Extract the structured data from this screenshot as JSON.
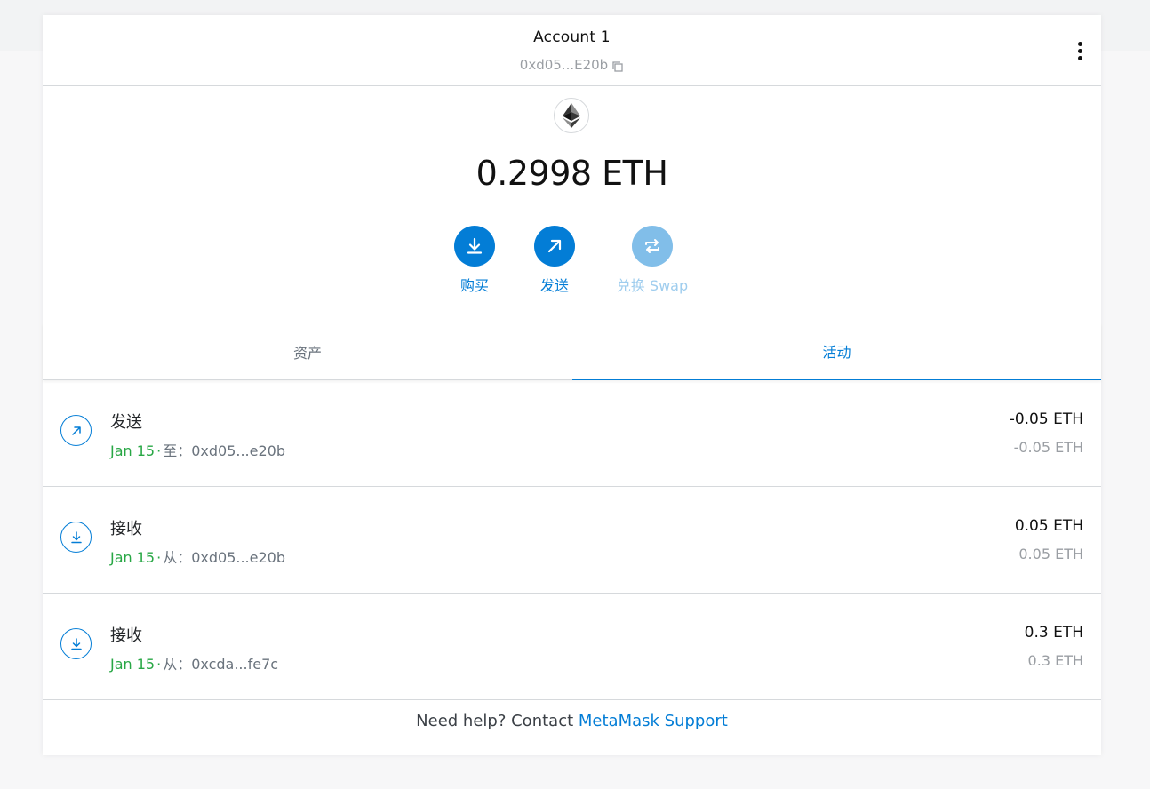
{
  "account": {
    "name": "Account 1",
    "address": "0xd05...E20b"
  },
  "balance": {
    "text": "0.2998 ETH"
  },
  "actions": {
    "buy": "购买",
    "send": "发送",
    "swap": "兑换 Swap"
  },
  "tabs": {
    "assets": "资产",
    "activity": "活动"
  },
  "transactions": [
    {
      "title": "发送",
      "date": "Jan 15",
      "direction": "至：",
      "address": "0xd05...e20b",
      "amount": "-0.05 ETH",
      "fiat": "-0.05 ETH",
      "icon": "send-arrow-icon"
    },
    {
      "title": "接收",
      "date": "Jan 15",
      "direction": "从：",
      "address": "0xd05...e20b",
      "amount": "0.05 ETH",
      "fiat": "0.05 ETH",
      "icon": "receive-icon"
    },
    {
      "title": "接收",
      "date": "Jan 15",
      "direction": "从：",
      "address": "0xcda...fe7c",
      "amount": "0.3 ETH",
      "fiat": "0.3 ETH",
      "icon": "receive-icon"
    }
  ],
  "help": {
    "prefix": "Need help? Contact ",
    "link": "MetaMask Support"
  },
  "colors": {
    "accent": "#037dd6",
    "accent_disabled": "#81bee9",
    "date_green": "#28a745"
  }
}
